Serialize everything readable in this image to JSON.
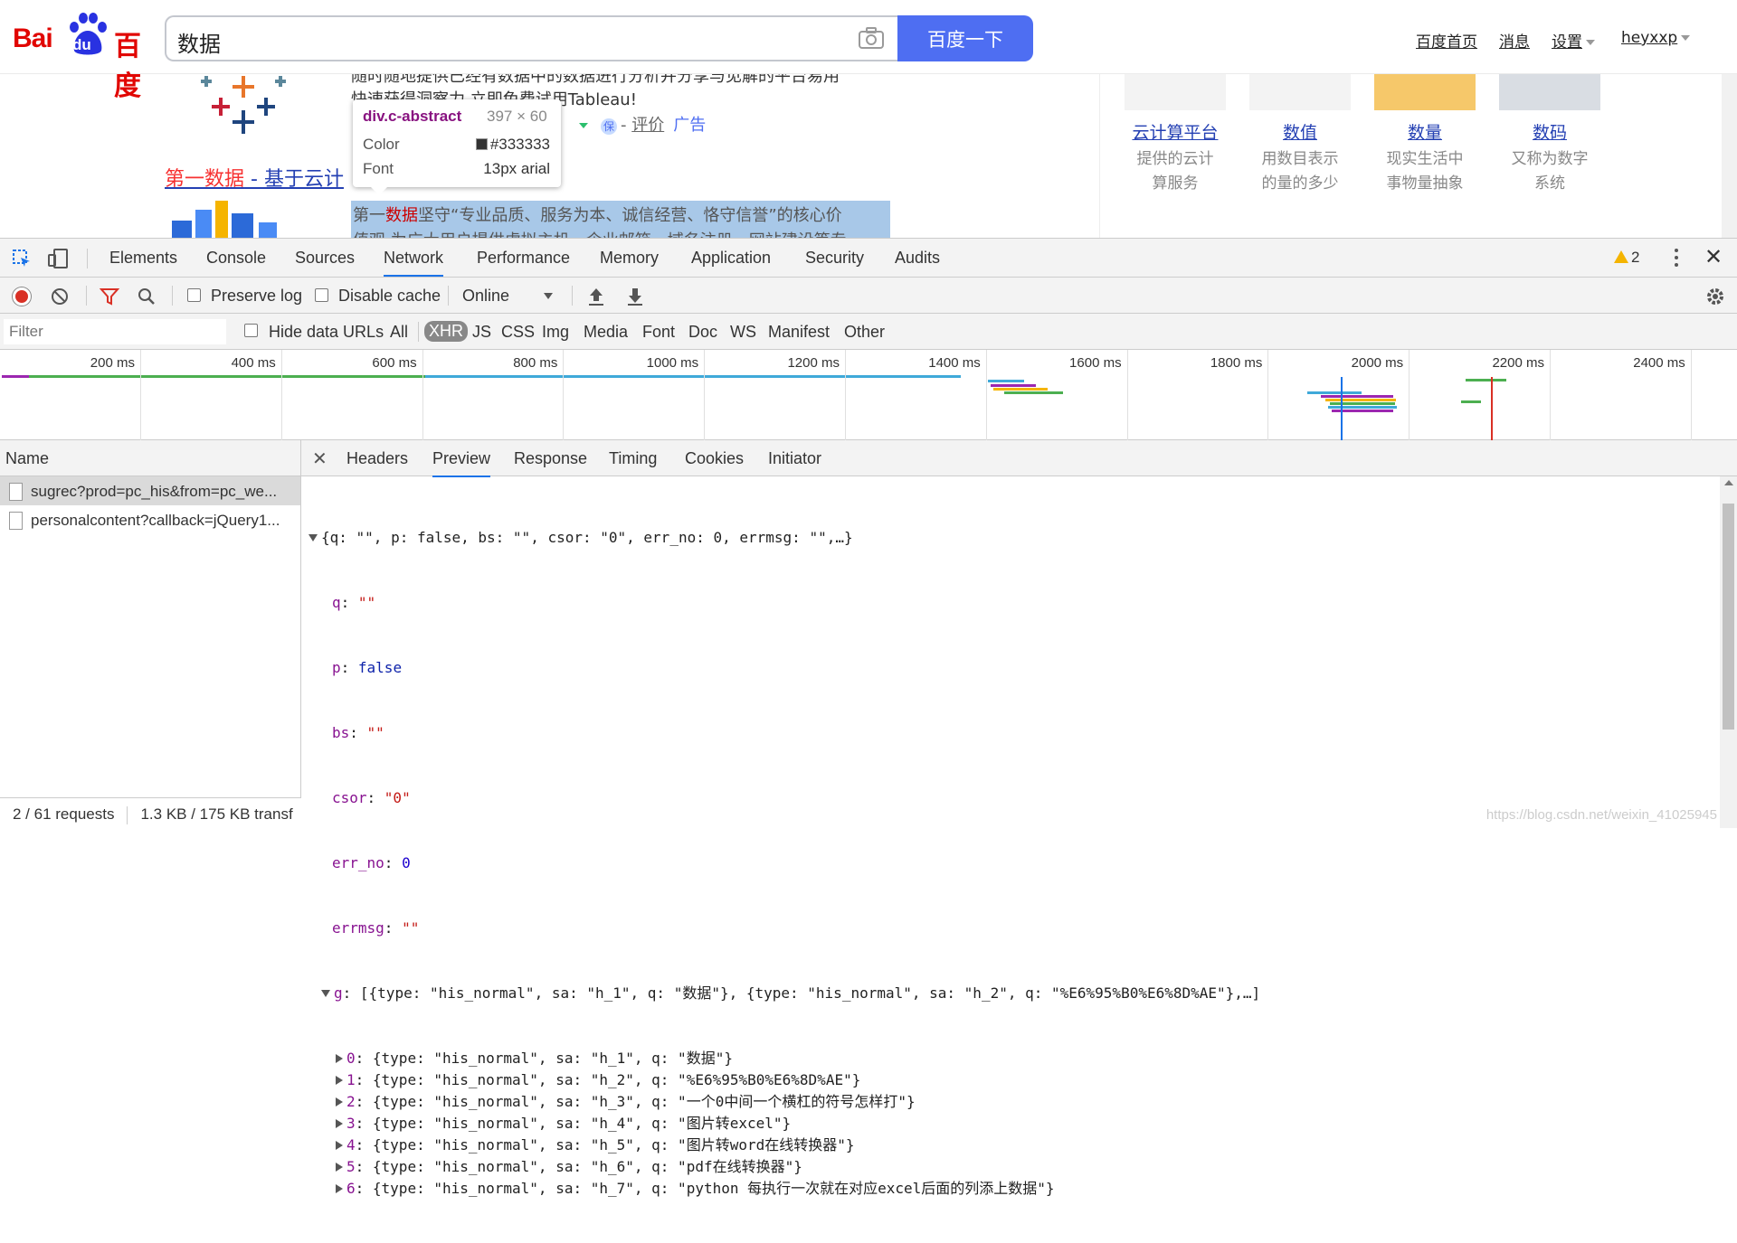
{
  "baidu": {
    "logo": {
      "bai": "Bai",
      "du": "du",
      "zh": "百度"
    },
    "search": {
      "query": "数据",
      "button": "百度一下"
    },
    "nav": [
      "百度首页",
      "消息",
      "设置",
      "heyxxp"
    ],
    "ad": {
      "line1": "随时随地提供已经有数据中的数据进行分析并分享与见解的平台易用",
      "line2": "快速获得洞察力 立即免费试用Tableau!",
      "review": "评价",
      "ad_tag": "广告"
    },
    "result": {
      "title_em": "第一数据",
      "title_rest": " - 基于云计"
    },
    "abstract": {
      "prefix": "第一",
      "em": "数据",
      "text": "坚守“专业品质、服务为本、诚信经营、恪守信誉”的核心价",
      "text2": "值观,为广大用户提供虚拟主机、企业邮箱、域名注册、网站建设等专"
    },
    "tooltip": {
      "selector": "div.c-abstract",
      "dims": "397 × 60",
      "color_label": "Color",
      "color_value": "#333333",
      "font_label": "Font",
      "font_value": "13px arial"
    },
    "cards": [
      {
        "name": "云计算平台",
        "desc1": "提供的云计",
        "desc2": "算服务"
      },
      {
        "name": "数值",
        "desc1": "用数目表示",
        "desc2": "的量的多少"
      },
      {
        "name": "数量",
        "desc1": "现实生活中",
        "desc2": "事物量抽象"
      },
      {
        "name": "数码",
        "desc1": "又称为数字",
        "desc2": "系统"
      }
    ]
  },
  "devtools": {
    "tabs": [
      "Elements",
      "Console",
      "Sources",
      "Network",
      "Performance",
      "Memory",
      "Application",
      "Security",
      "Audits"
    ],
    "active_tab": "Network",
    "warnings": "2",
    "toolbar": {
      "preserve_log": "Preserve log",
      "disable_cache": "Disable cache",
      "throttle": "Online"
    },
    "filter": {
      "placeholder": "Filter",
      "hide_data_urls": "Hide data URLs",
      "types": [
        "All",
        "XHR",
        "JS",
        "CSS",
        "Img",
        "Media",
        "Font",
        "Doc",
        "WS",
        "Manifest",
        "Other"
      ],
      "selected_type": "XHR"
    },
    "timeline_labels": [
      "200 ms",
      "400 ms",
      "600 ms",
      "800 ms",
      "1000 ms",
      "1200 ms",
      "1400 ms",
      "1600 ms",
      "1800 ms",
      "2000 ms",
      "2200 ms",
      "2400 ms"
    ],
    "name_header": "Name",
    "requests": [
      "sugrec?prod=pc_his&from=pc_we...",
      "personalcontent?callback=jQuery1..."
    ],
    "status": {
      "requests": "2 / 61 requests",
      "transferred": "1.3 KB / 175 KB transf"
    },
    "detail_tabs": [
      "Headers",
      "Preview",
      "Response",
      "Timing",
      "Cookies",
      "Initiator"
    ],
    "active_detail_tab": "Preview",
    "preview": {
      "summary": "{q: \"\", p: false, bs: \"\", csor: \"0\", err_no: 0, errmsg: \"\",…}",
      "g_summary": "[{type: \"his_normal\", sa: \"h_1\", q: \"数据\"}, {type: \"his_normal\", sa: \"h_2\", q: \"%E6%95%B0%E6%8D%AE\"},…]",
      "g_items": [
        "{type: \"his_normal\", sa: \"h_1\", q: \"数据\"}",
        "{type: \"his_normal\", sa: \"h_2\", q: \"%E6%95%B0%E6%8D%AE\"}",
        "{type: \"his_normal\", sa: \"h_3\", q: \"一个0中间一个横杠的符号怎样打\"}",
        "{type: \"his_normal\", sa: \"h_4\", q: \"图片转excel\"}",
        "{type: \"his_normal\", sa: \"h_5\", q: \"图片转word在线转换器\"}",
        "{type: \"his_normal\", sa: \"h_6\", q: \"pdf在线转换器\"}",
        "{type: \"his_normal\", sa: \"h_7\", q: \"python 每执行一次就在对应excel后面的列添上数据\"}"
      ]
    },
    "watermark": "https://blog.csdn.net/weixin_41025945"
  }
}
